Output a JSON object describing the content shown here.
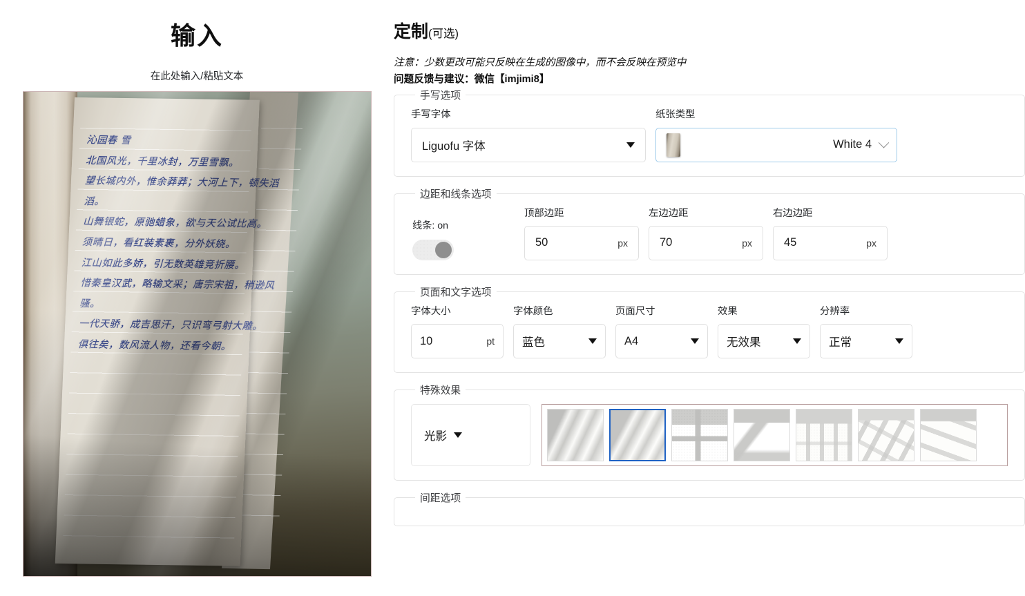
{
  "left": {
    "title": "输入",
    "subtitle": "在此处输入/粘贴文本",
    "handwriting_lines": "沁园春 雪\n北国风光，千里冰封，万里雪飘。\n望长城内外，惟余莽莽；大河上下，顿失滔\n滔。\n山舞银蛇，原驰蜡象，欲与天公试比高。\n须晴日，看红装素裹，分外妖娆。\n江山如此多娇，引无数英雄竞折腰。\n惜秦皇汉武，略输文采；唐宗宋祖，稍逊风\n骚。\n一代天骄，成吉思汗，只识弯弓射大雕。\n俱往矣，数风流人物，还看今朝。"
  },
  "right": {
    "title_main": "定制",
    "title_paren": "(可选)",
    "note": "注意：少数更改可能只反映在生成的图像中，而不会反映在预览中",
    "feedback": "问题反馈与建议：微信【imjimi8】",
    "handwriting_group": {
      "legend": "手写选项",
      "font_label": "手写字体",
      "font_value": "Liguofu 字体",
      "paper_label": "纸张类型",
      "paper_value": "White 4"
    },
    "margins_group": {
      "legend": "边距和线条选项",
      "lines_label": "线条: on",
      "lines_state": "on",
      "top_label": "顶部边距",
      "top_value": "50",
      "left_label": "左边边距",
      "left_value": "70",
      "right_label": "右边边距",
      "right_value": "45",
      "unit": "px"
    },
    "page_group": {
      "legend": "页面和文字选项",
      "font_size_label": "字体大小",
      "font_size_value": "10",
      "font_size_unit": "pt",
      "font_color_label": "字体颜色",
      "font_color_value": "蓝色",
      "page_size_label": "页面尺寸",
      "page_size_value": "A4",
      "effect_label": "效果",
      "effect_value": "无效果",
      "resolution_label": "分辨率",
      "resolution_value": "正常"
    },
    "effects_group": {
      "legend": "特殊效果",
      "effect_type_value": "光影",
      "selected_index": 1,
      "thumbnails": [
        "curtain-fold-shadow-1",
        "curtain-fold-shadow-2",
        "window-cross-shadow-1",
        "window-diagonal-shadow",
        "window-grid-shadow-1",
        "window-grid-shadow-2",
        "window-slats-shadow"
      ]
    },
    "spacing_group": {
      "legend": "间距选项"
    }
  },
  "colors": {
    "accent_selected": "#1f62c4",
    "gallery_border": "#b79c9c",
    "focus_border": "#9fcbea",
    "ink": "#2f3f84",
    "group_border": "#e3e3e3"
  }
}
